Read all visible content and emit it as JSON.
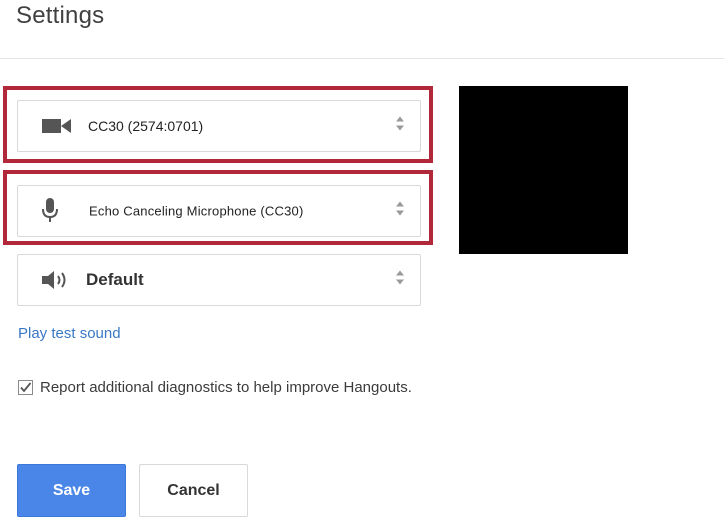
{
  "page": {
    "title": "Settings"
  },
  "camera": {
    "value": "CC30 (2574:0701)",
    "icon": "video-camera-icon"
  },
  "microphone": {
    "value": "Echo Canceling Microphone (CC30)",
    "icon": "microphone-icon"
  },
  "speaker": {
    "value": "Default",
    "icon": "speaker-icon"
  },
  "play_test_sound": "Play test sound",
  "diagnostics": {
    "label": "Report additional diagnostics to help improve Hangouts.",
    "checked": true
  },
  "actions": {
    "save_label": "Save",
    "cancel_label": "Cancel"
  },
  "colors": {
    "highlight": "#b0283a",
    "primary": "#4a86e8",
    "link": "#3b78c4",
    "preview_background": "#000000"
  }
}
